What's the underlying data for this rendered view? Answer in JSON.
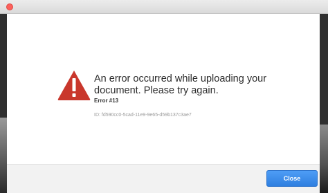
{
  "dialog": {
    "message": "An error occurred while uploading your document. Please try again.",
    "error_code": "Error #13",
    "error_id": "ID: fd590cc0-5cad-11e9-9e65-d59b137c3ae7",
    "icon": "warning-triangle-icon"
  },
  "footer": {
    "close_label": "Close"
  },
  "colors": {
    "warning": "#c9372c",
    "button": "#3a86e8",
    "titlebar_close": "#fc605c"
  }
}
